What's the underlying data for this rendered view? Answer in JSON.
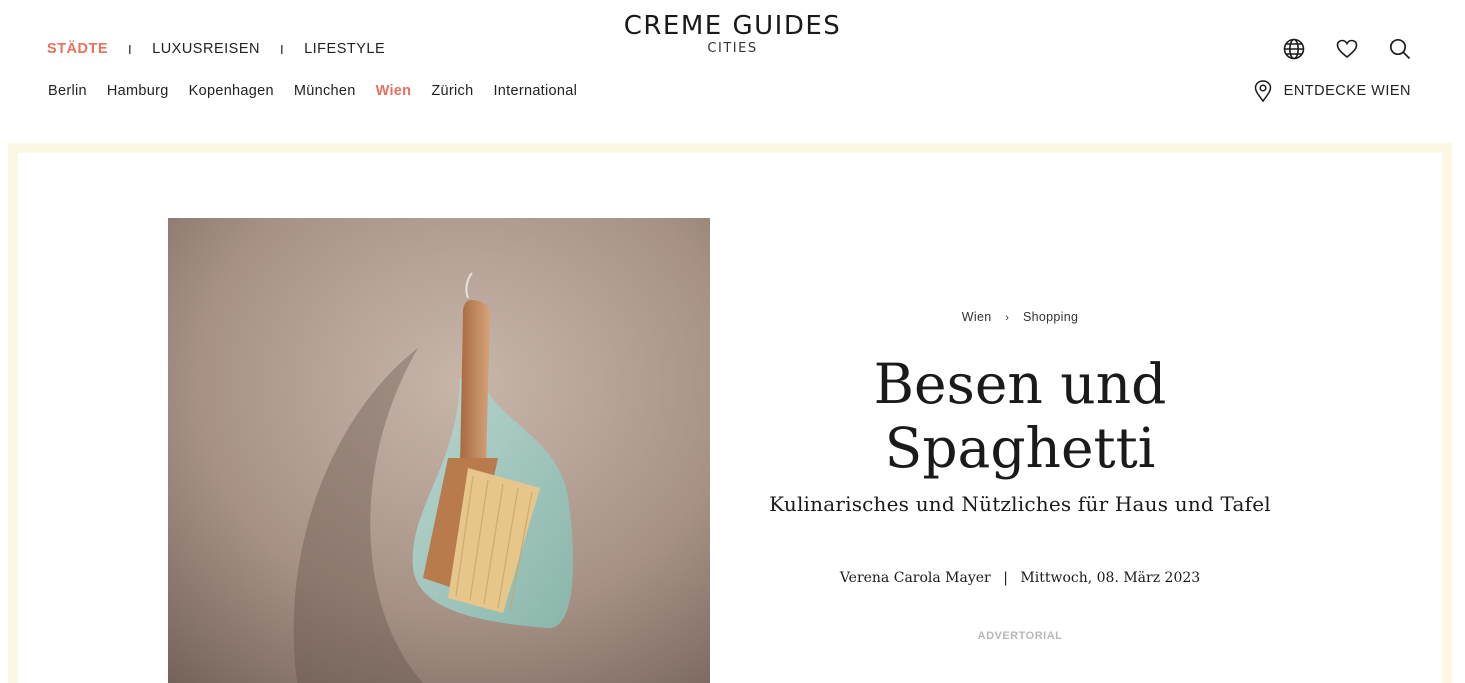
{
  "logo": {
    "title": "CREME GUIDES",
    "subtitle": "CITIES"
  },
  "top_nav": [
    {
      "label": "STÄDTE",
      "active": true
    },
    {
      "label": "LUXUSREISEN",
      "active": false
    },
    {
      "label": "LIFESTYLE",
      "active": false
    }
  ],
  "top_nav_separator": "I",
  "cities": [
    {
      "label": "Berlin",
      "active": false
    },
    {
      "label": "Hamburg",
      "active": false
    },
    {
      "label": "Kopenhagen",
      "active": false
    },
    {
      "label": "München",
      "active": false
    },
    {
      "label": "Wien",
      "active": true
    },
    {
      "label": "Zürich",
      "active": false
    },
    {
      "label": "International",
      "active": false
    }
  ],
  "header_icons": [
    "globe-icon",
    "heart-icon",
    "search-icon"
  ],
  "discover": {
    "icon": "map-pin-icon",
    "label": "ENTDECKE WIEN"
  },
  "colors": {
    "accent": "#e8705f",
    "frame": "#fdf8e4"
  },
  "hero_image": {
    "subject": "brush-and-dustpan-photo"
  },
  "article": {
    "breadcrumb": [
      "Wien",
      "Shopping"
    ],
    "breadcrumb_arrow": "›",
    "title_line1": "Besen und",
    "title_line2": "Spaghetti",
    "subtitle": "Kulinarisches und Nützliches für Haus und Tafel",
    "author": "Verena Carola Mayer",
    "meta_separator": "|",
    "date": "Mittwoch, 08. März 2023",
    "label": "ADVERTORIAL"
  }
}
